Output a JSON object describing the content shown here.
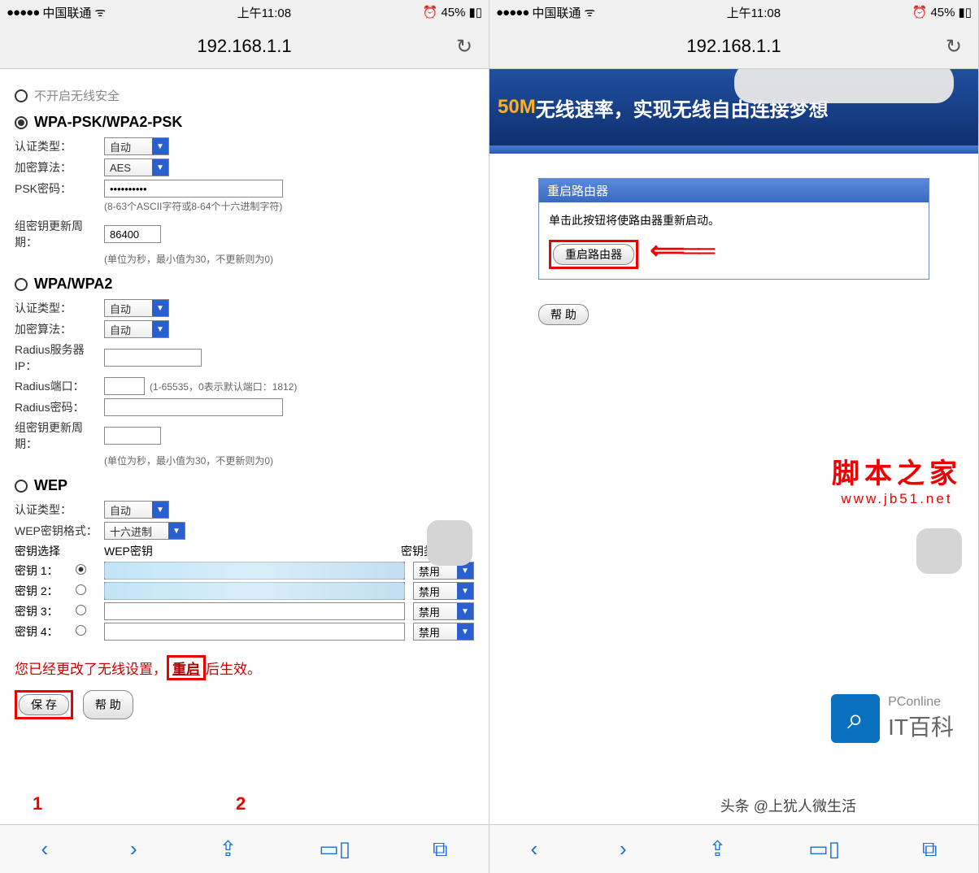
{
  "statusbar": {
    "carrier": "中国联通",
    "time": "上午11:08",
    "alarm": "⏰",
    "battery_pct": "45%",
    "battery_icon": "■"
  },
  "browser": {
    "url": "192.168.1.1",
    "refresh": "↻"
  },
  "left": {
    "top_option": "不开启无线安全",
    "wpapsk": {
      "title": "WPA-PSK/WPA2-PSK",
      "auth_label": "认证类型：",
      "auth_val": "自动",
      "enc_label": "加密算法：",
      "enc_val": "AES",
      "psk_label": "PSK密码：",
      "psk_val": "••••••••••",
      "psk_hint": "(8-63个ASCII字符或8-64个十六进制字符)",
      "gk_label": "组密钥更新周期：",
      "gk_val": "86400",
      "gk_hint": "(单位为秒，最小值为30，不更新则为0)"
    },
    "wpa": {
      "title": "WPA/WPA2",
      "auth_label": "认证类型：",
      "auth_val": "自动",
      "enc_label": "加密算法：",
      "enc_val": "自动",
      "rip_label": "Radius服务器IP：",
      "rport_label": "Radius端口：",
      "rport_hint": "(1-65535，0表示默认端口：1812)",
      "rpwd_label": "Radius密码：",
      "gk_label": "组密钥更新周期：",
      "gk_hint": "(单位为秒，最小值为30，不更新则为0)"
    },
    "wep": {
      "title": "WEP",
      "auth_label": "认证类型：",
      "auth_val": "自动",
      "fmt_label": "WEP密钥格式：",
      "fmt_val": "十六进制",
      "keysel_label": "密钥选择",
      "wepkey_label": "WEP密钥",
      "keytype_label": "密钥类型",
      "k1": "密钥 1：",
      "k2": "密钥 2：",
      "k3": "密钥 3：",
      "k4": "密钥 4：",
      "disabled": "禁用"
    },
    "msg_before": "您已经更改了无线设置，",
    "msg_link": "重启",
    "msg_after": "后生效。",
    "save": "保 存",
    "help": "帮 助",
    "anno1": "1",
    "anno2": "2"
  },
  "right": {
    "banner_num": "50M",
    "banner_txt": "无线速率，实现无线自由连接梦想",
    "panel_title": "重启路由器",
    "panel_text": "单击此按钮将使路由器重新启动。",
    "restart_btn": "重启路由器",
    "help": "帮 助",
    "wm1_cn": "脚本之家",
    "wm1_url": "www.jb51.net",
    "wm2_en": "PConline",
    "wm2_cn": "IT百科"
  },
  "attribution": "头条 @上犹人微生活",
  "toolbar": {
    "back": "‹",
    "fwd": "›",
    "share": "⇪",
    "book": "▭▯",
    "tabs": "⧉"
  }
}
